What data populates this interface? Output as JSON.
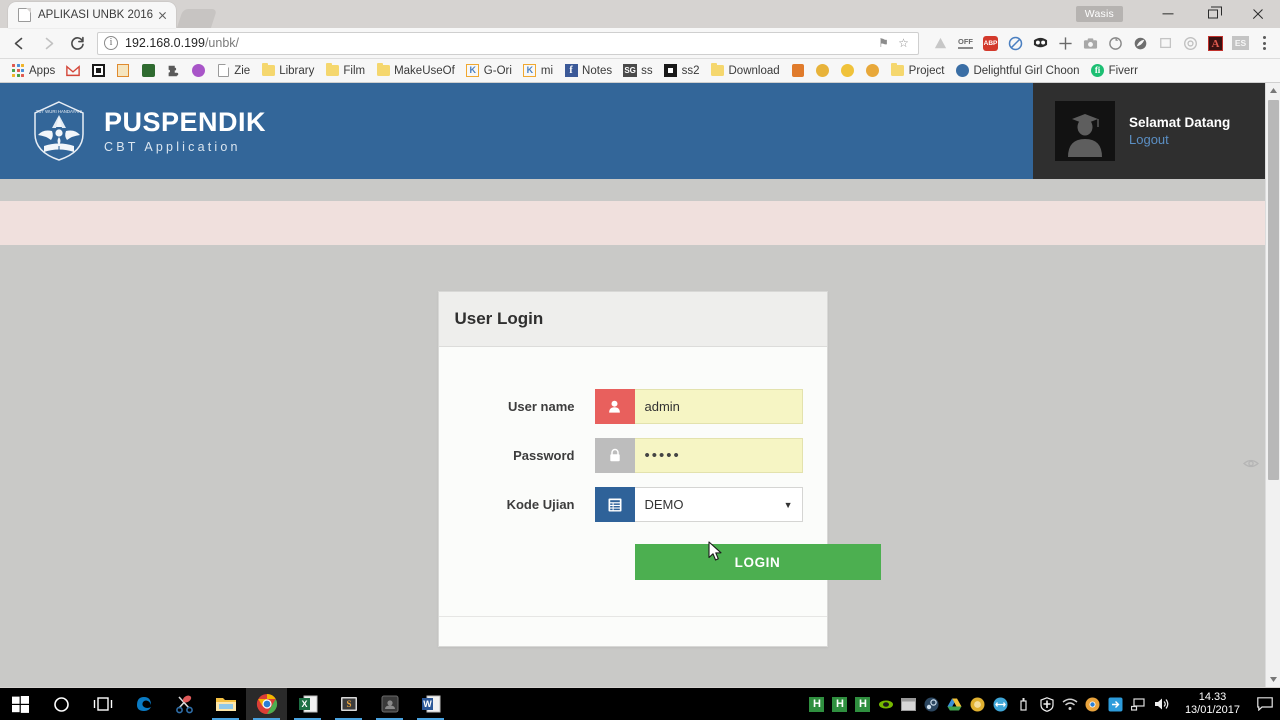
{
  "browser": {
    "tab": {
      "title": "APLIKASI UNBK 2016",
      "favicon": "page-icon",
      "close": "×"
    },
    "new_tab_label": "+",
    "profile_name": "Wasis",
    "window_controls": {
      "minimize": "minimize-icon",
      "maximize": "maximize-icon",
      "close": "close-icon"
    },
    "nav": {
      "back": "◀",
      "forward": "▶",
      "reload": "⟳"
    },
    "omnibox": {
      "info_glyph": "i",
      "url_host": "192.168.0.199",
      "url_path": "/unbk/",
      "star": "☆",
      "bookmark_pin": "⚑"
    },
    "extensions": [
      {
        "name": "google-drive-icon",
        "glyph": "△",
        "color": "#c2c2c2"
      },
      {
        "name": "off-toggle-icon",
        "glyph": "OFF",
        "color": "#8a8a8a"
      },
      {
        "name": "adblock-plus-icon",
        "glyph": "ABP",
        "color": "#d33a2c"
      },
      {
        "name": "no-entry-icon",
        "glyph": "⊘",
        "color": "#4a7fc1"
      },
      {
        "name": "mask-icon",
        "glyph": "◕",
        "color": "#2b2b2b"
      },
      {
        "name": "crosshair-icon",
        "glyph": "✛",
        "color": "#6a6a6a"
      },
      {
        "name": "camera-icon",
        "glyph": "◉",
        "color": "#9a9a9a"
      },
      {
        "name": "refresh-circle-icon",
        "glyph": "↻",
        "color": "#8a8a8a"
      },
      {
        "name": "opera-leaf-icon",
        "glyph": "◍",
        "color": "#6e6e6e"
      },
      {
        "name": "popout-window-icon",
        "glyph": "❐",
        "color": "#c4c4c4"
      },
      {
        "name": "circle-target-icon",
        "glyph": "◎",
        "color": "#c0c0c0"
      },
      {
        "name": "adobe-reader-icon",
        "glyph": "A",
        "color": "#c2312c"
      },
      {
        "name": "es-translate-icon",
        "glyph": "ES",
        "color": "#9a9a9a"
      }
    ],
    "menu": "chrome-menu-icon",
    "bookmarks": [
      {
        "label": "Apps",
        "icon": "apps-grid-icon"
      },
      {
        "label": "",
        "icon": "gmail-icon"
      },
      {
        "label": "",
        "icon": "black-square-icon"
      },
      {
        "label": "",
        "icon": "book-icon"
      },
      {
        "label": "",
        "icon": "green-shield-icon"
      },
      {
        "label": "",
        "icon": "puzzle-icon"
      },
      {
        "label": "",
        "icon": "purple-circle-icon"
      },
      {
        "label": "Zie",
        "icon": "page-icon"
      },
      {
        "label": "Library",
        "icon": "folder-icon"
      },
      {
        "label": "Film",
        "icon": "folder-icon"
      },
      {
        "label": "MakeUseOf",
        "icon": "folder-icon"
      },
      {
        "label": "G-Ori",
        "icon": "k-icon"
      },
      {
        "label": "mi",
        "icon": "k-icon"
      },
      {
        "label": "Notes",
        "icon": "facebook-icon"
      },
      {
        "label": "ss",
        "icon": "sg-icon"
      },
      {
        "label": "ss2",
        "icon": "dark-square-icon"
      },
      {
        "label": "Download",
        "icon": "folder-icon"
      },
      {
        "label": "",
        "icon": "orange-tag-icon"
      },
      {
        "label": "",
        "icon": "emoji-cool-icon"
      },
      {
        "label": "",
        "icon": "emoji-wink-icon"
      },
      {
        "label": "",
        "icon": "emoji-scream-icon"
      },
      {
        "label": "Project",
        "icon": "folder-icon"
      },
      {
        "label": "Delightful Girl Choon",
        "icon": "globe-icon"
      },
      {
        "label": "Fiverr",
        "icon": "fiverr-icon"
      }
    ]
  },
  "page": {
    "header": {
      "logo": "tut-wuri-handayani-logo",
      "title": "PUSPENDIK",
      "subtitle": "CBT Application",
      "bg_color": "#336699"
    },
    "user": {
      "avatar": "graduate-avatar",
      "greeting": "Selamat Datang",
      "logout_label": "Logout"
    },
    "alert_bar": {
      "text": "",
      "bg_color": "#f0e0dd"
    },
    "login_panel": {
      "heading": "User Login",
      "fields": [
        {
          "label": "User name",
          "icon": "user-icon",
          "icon_color": "#e8605d",
          "value": "admin",
          "type": "text"
        },
        {
          "label": "Password",
          "icon": "lock-icon",
          "icon_color": "#bdbdbd",
          "value": "•••••",
          "type": "password"
        },
        {
          "label": "Kode Ujian",
          "icon": "list-icon",
          "icon_color": "#2f6299",
          "value": "DEMO",
          "type": "select",
          "caret": "▼"
        }
      ],
      "show_password_icon": "eye-icon",
      "submit_label": "LOGIN",
      "submit_color": "#4caf50"
    },
    "scrollbar": {
      "up": "▲",
      "down": "▼"
    }
  },
  "taskbar": {
    "items": [
      {
        "name": "start-button",
        "icon": "windows-logo-icon",
        "open": false,
        "active": false
      },
      {
        "name": "search-button",
        "icon": "search-circle-icon",
        "open": false,
        "active": false
      },
      {
        "name": "task-view-button",
        "icon": "task-view-icon",
        "open": false,
        "active": false
      },
      {
        "name": "edge-button",
        "icon": "edge-icon",
        "open": false,
        "active": false
      },
      {
        "name": "snipping-tool-button",
        "icon": "scissors-icon",
        "open": false,
        "active": false
      },
      {
        "name": "file-explorer-button",
        "icon": "folder-icon",
        "open": true,
        "active": false
      },
      {
        "name": "chrome-button",
        "icon": "chrome-icon",
        "open": true,
        "active": true
      },
      {
        "name": "excel-button",
        "icon": "excel-icon",
        "open": true,
        "active": false
      },
      {
        "name": "sublime-button",
        "icon": "sublime-icon",
        "open": true,
        "active": false
      },
      {
        "name": "app-button",
        "icon": "dark-app-icon",
        "open": true,
        "active": false
      },
      {
        "name": "word-button",
        "icon": "word-icon",
        "open": true,
        "active": false
      }
    ],
    "tray": [
      {
        "name": "h-icon-1",
        "glyph": "H",
        "color": "#2f8f3f"
      },
      {
        "name": "h-icon-2",
        "glyph": "H",
        "color": "#2f8f3f"
      },
      {
        "name": "h-icon-3",
        "glyph": "H",
        "color": "#2f8f3f"
      },
      {
        "name": "nvidia-icon",
        "glyph": "◉",
        "color": "#76b900"
      },
      {
        "name": "window-icon",
        "glyph": "▤",
        "color": "#cfcfcf"
      },
      {
        "name": "steam-icon",
        "glyph": "◎",
        "color": "#6d9ec4"
      },
      {
        "name": "google-drive-icon",
        "glyph": "▲",
        "color": "#4aa14a"
      },
      {
        "name": "ccleaner-icon",
        "glyph": "◍",
        "color": "#e0b030"
      },
      {
        "name": "teamviewer-icon",
        "glyph": "↔",
        "color": "#3fa6d8"
      },
      {
        "name": "usb-eject-icon",
        "glyph": "⏏",
        "color": "#e6e6e6"
      },
      {
        "name": "defender-shield-icon",
        "glyph": "✛",
        "color": "#eeeeee"
      },
      {
        "name": "wifi-icon",
        "glyph": "≋",
        "color": "#cfcfcf"
      },
      {
        "name": "chrome-icon",
        "glyph": "◉",
        "color": "#e8a33d"
      },
      {
        "name": "idm-icon",
        "glyph": "⇥",
        "color": "#2d9cdb"
      },
      {
        "name": "network-icon",
        "glyph": "🖧",
        "color": "#dddddd"
      },
      {
        "name": "volume-icon",
        "glyph": "🔊",
        "color": "#eeeeee"
      }
    ],
    "clock": {
      "time": "14.33",
      "date": "13/01/2017"
    },
    "action_center": "notification-icon"
  }
}
